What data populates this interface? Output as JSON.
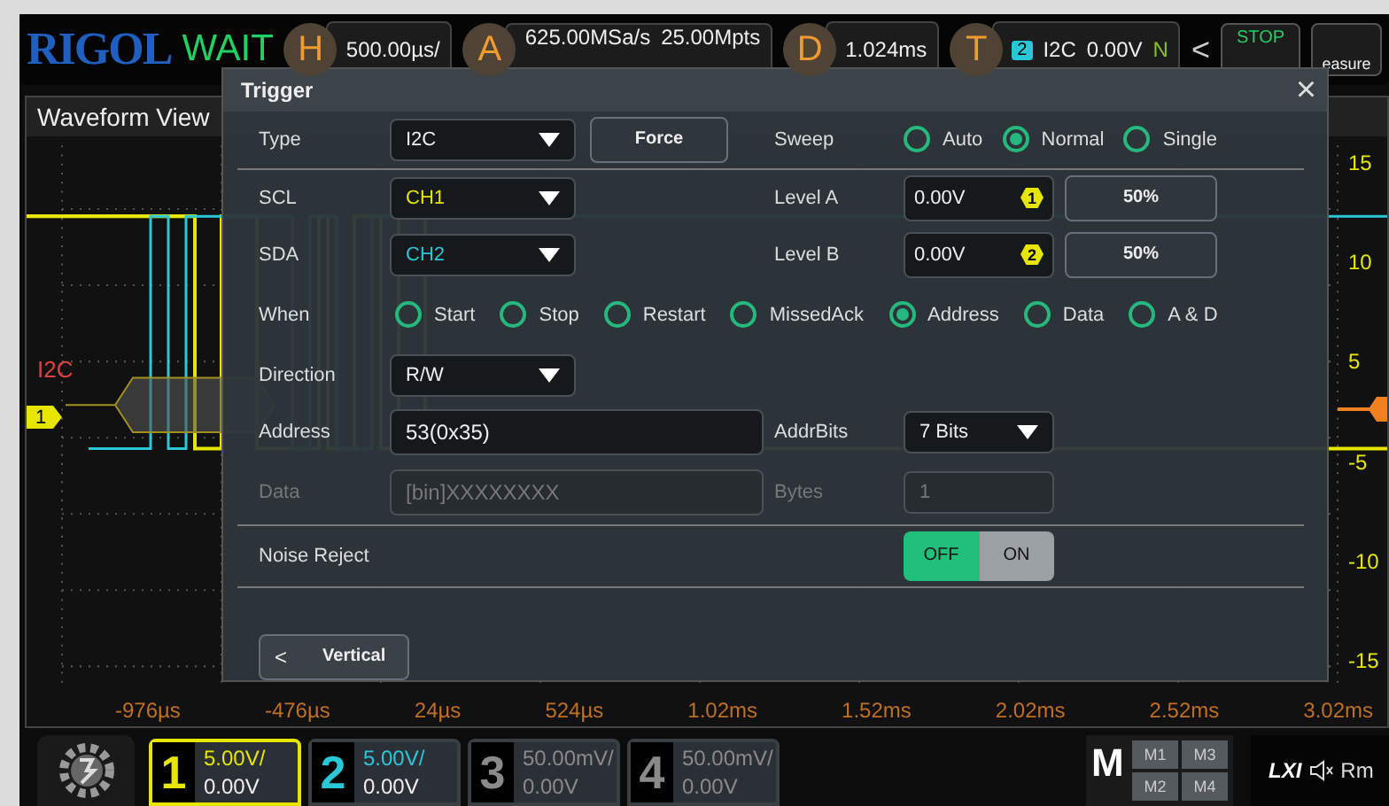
{
  "top_bar": {
    "logo": "RIGOL",
    "status": "WAIT",
    "horizontal": {
      "key": "H",
      "value": "500.00µs/"
    },
    "acquire": {
      "key": "A",
      "sample_rate": "625.00MSa/s",
      "depth": "25.00Mpts"
    },
    "delay": {
      "key": "D",
      "value": "1.024ms"
    },
    "trigger": {
      "key": "T",
      "source": "2",
      "type": "I2C",
      "level": "0.00V",
      "mode": "N"
    },
    "collapse": "<",
    "run_button": "STOP",
    "measure_button": "easure"
  },
  "waveform_view": {
    "title": "Waveform View",
    "bus_label": "I2C",
    "channel_marker": "1",
    "volt_labels": [
      "15",
      "10",
      "5",
      "-5",
      "-10",
      "-15"
    ],
    "time_labels": [
      "-976µs",
      "-476µs",
      "24µs",
      "524µs",
      "1.02ms",
      "1.52ms",
      "2.02ms",
      "2.52ms",
      "3.02ms"
    ]
  },
  "dialog": {
    "title": "Trigger",
    "close": "×",
    "type": {
      "label": "Type",
      "value": "I2C"
    },
    "force_button": "Force",
    "sweep": {
      "label": "Sweep",
      "options": [
        {
          "label": "Auto",
          "selected": false
        },
        {
          "label": "Normal",
          "selected": true
        },
        {
          "label": "Single",
          "selected": false
        }
      ]
    },
    "scl": {
      "label": "SCL",
      "value": "CH1",
      "color": "#e6e600"
    },
    "sda": {
      "label": "SDA",
      "value": "CH2",
      "color": "#28c8d8"
    },
    "level_a": {
      "label": "Level A",
      "value": "0.00V",
      "badge": "1",
      "button": "50%"
    },
    "level_b": {
      "label": "Level B",
      "value": "0.00V",
      "badge": "2",
      "button": "50%"
    },
    "when": {
      "label": "When",
      "options": [
        {
          "label": "Start",
          "selected": false
        },
        {
          "label": "Stop",
          "selected": false
        },
        {
          "label": "Restart",
          "selected": false
        },
        {
          "label": "MissedAck",
          "selected": false
        },
        {
          "label": "Address",
          "selected": true
        },
        {
          "label": "Data",
          "selected": false
        },
        {
          "label": "A & D",
          "selected": false
        }
      ]
    },
    "direction": {
      "label": "Direction",
      "value": "R/W"
    },
    "address": {
      "label": "Address",
      "value": "53(0x35)"
    },
    "addr_bits": {
      "label": "AddrBits",
      "value": "7 Bits"
    },
    "data": {
      "label": "Data",
      "placeholder": "[bin]XXXXXXXX",
      "disabled": true
    },
    "bytes": {
      "label": "Bytes",
      "value": "1",
      "disabled": true
    },
    "noise_reject": {
      "label": "Noise Reject",
      "options": [
        {
          "label": "OFF",
          "selected": true
        },
        {
          "label": "ON",
          "selected": false
        }
      ]
    },
    "back_button": {
      "icon": "<",
      "label": "Vertical"
    }
  },
  "bottom_bar": {
    "channels": [
      {
        "number": "1",
        "scale": "5.00V/",
        "offset": "0.00V",
        "color": "#e6e600",
        "selected": true
      },
      {
        "number": "2",
        "scale": "5.00V/",
        "offset": "0.00V",
        "color": "#28c8d8",
        "selected": false
      },
      {
        "number": "3",
        "scale": "50.00mV/",
        "offset": "0.00V",
        "color": "#8a8a8a",
        "selected": false
      },
      {
        "number": "4",
        "scale": "50.00mV/",
        "offset": "0.00V",
        "color": "#8a8a8a",
        "selected": false
      }
    ],
    "math": {
      "label": "M",
      "buttons": [
        "M1",
        "M3",
        "M2",
        "M4"
      ]
    },
    "status": {
      "lxi": "LXI",
      "remote": "Rm"
    }
  }
}
